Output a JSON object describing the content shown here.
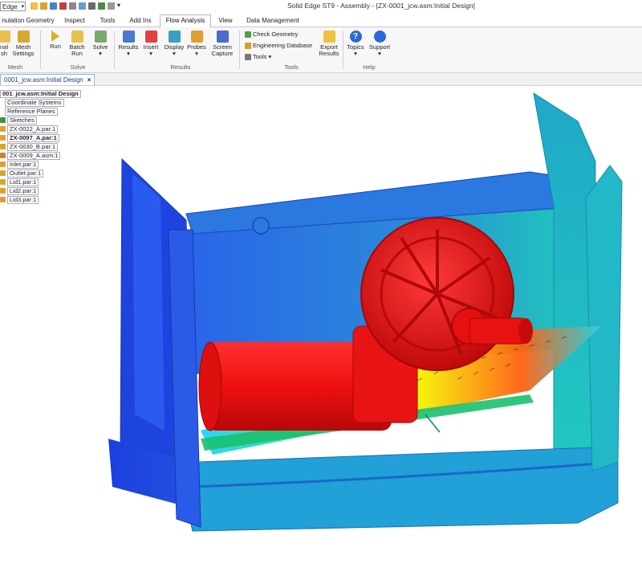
{
  "title_bar": {
    "app_dropdown": "Edge",
    "window_title": "Solid Edge ST9 - Assembly - [ZX-0001_jcw.asm:Initial Design]"
  },
  "tabs": [
    {
      "label": "nulation Geometry"
    },
    {
      "label": "Inspect"
    },
    {
      "label": "Tools"
    },
    {
      "label": "Add Ins"
    },
    {
      "label": "Flow Analysis"
    },
    {
      "label": "View"
    },
    {
      "label": "Data Management"
    }
  ],
  "ribbon": {
    "mesh_group": {
      "buttons": [
        {
          "line1": "nal",
          "line2": "sh"
        },
        {
          "line1": "Mesh",
          "line2": "Settings"
        }
      ],
      "label": "Mesh"
    },
    "solve_group": {
      "buttons": [
        {
          "line1": "Run",
          "line2": ""
        },
        {
          "line1": "Batch",
          "line2": "Run"
        },
        {
          "line1": "Solve",
          "line2": ""
        }
      ],
      "label": "Solve"
    },
    "results_group": {
      "buttons": [
        {
          "line1": "Results",
          "line2": ""
        },
        {
          "line1": "Insert",
          "line2": ""
        },
        {
          "line1": "Display",
          "line2": ""
        },
        {
          "line1": "Probes",
          "line2": ""
        },
        {
          "line1": "Screen",
          "line2": "Capture"
        }
      ],
      "label": "Results"
    },
    "tools_group": {
      "items": [
        {
          "label": "Check Geometry"
        },
        {
          "label": "Engineering Database"
        },
        {
          "label": "Tools"
        }
      ],
      "export": {
        "line1": "Export",
        "line2": "Results"
      },
      "label": "Tools"
    },
    "help_group": {
      "buttons": [
        {
          "label": "Topics"
        },
        {
          "label": "Support"
        }
      ],
      "label": "Help"
    }
  },
  "document_tab": {
    "label": "0001_jcw.asm:Initial Design",
    "close": "×"
  },
  "tree": [
    {
      "label": "001_jcw.asm:Initial Design"
    },
    {
      "label": "Coordinate Systems"
    },
    {
      "label": "Reference Planes"
    },
    {
      "label": "Sketches"
    },
    {
      "label": "ZX-0022_A.par:1"
    },
    {
      "label": "ZX-0097_A.par:1"
    },
    {
      "label": "ZX-0030_B.par:1"
    },
    {
      "label": "ZX-0009_A.asm:1"
    },
    {
      "label": "Inlet.par:1"
    },
    {
      "label": "Outlet.par:1"
    },
    {
      "label": "Lid1.par:1"
    },
    {
      "label": "Lid2.par:1"
    },
    {
      "label": "Lid3.par:1"
    }
  ],
  "colors": {
    "housing_blue": "#2a6be0",
    "housing_cyan": "#22c8c8",
    "motor_red": "#ee1111",
    "flow_yellow": "#f5f000",
    "flow_green": "#2ee85a"
  }
}
